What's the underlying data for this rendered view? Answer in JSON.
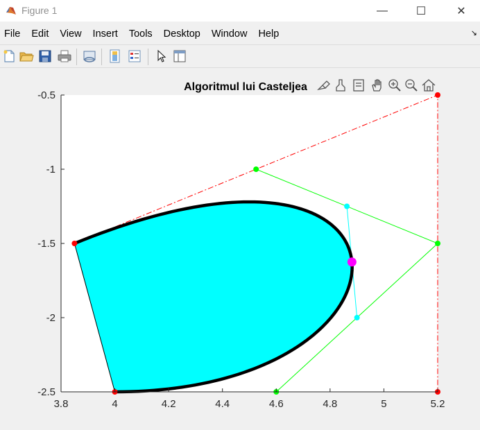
{
  "window": {
    "title": "Figure 1",
    "minimize_glyph": "—",
    "maximize_glyph": "☐",
    "close_glyph": "✕"
  },
  "menu": [
    "File",
    "Edit",
    "View",
    "Insert",
    "Tools",
    "Desktop",
    "Window",
    "Help"
  ],
  "toolbar": {
    "icons": [
      "new-figure-icon",
      "open-file-icon",
      "save-icon",
      "print-icon",
      "link-plot-icon",
      "colorbar-icon",
      "legend-icon",
      "pointer-icon",
      "property-editor-icon"
    ]
  },
  "axes_toolbar": {
    "icons": [
      "brush-edit-icon",
      "data-brush-icon",
      "datatip-icon",
      "pan-icon",
      "zoom-in-icon",
      "zoom-out-icon",
      "home-icon"
    ]
  },
  "colors": {
    "fill": "#00ffff",
    "curve": "#000000",
    "outer_polygon": "#ff0000",
    "level1": "#00ff00",
    "level2": "#00ffff",
    "point": "#ff00ff"
  },
  "chart_data": {
    "type": "line",
    "title": "Algoritmul lui Casteljea",
    "xlim": [
      3.8,
      5.2
    ],
    "ylim": [
      -2.5,
      -0.5
    ],
    "xticks": [
      "3.8",
      "4",
      "4.2",
      "4.4",
      "4.6",
      "4.8",
      "5",
      "5.2"
    ],
    "yticks": [
      "-0.5",
      "-1",
      "-1.5",
      "-2",
      "-2.5"
    ],
    "grid": false,
    "control_points": [
      [
        3.85,
        -1.5
      ],
      [
        5.2,
        -0.5
      ],
      [
        5.2,
        -2.5
      ],
      [
        4.0,
        -2.5
      ]
    ],
    "level1_points": [
      [
        4.525,
        -1.0
      ],
      [
        5.2,
        -1.5
      ],
      [
        4.6,
        -2.5
      ]
    ],
    "level2_points": [
      [
        4.8625,
        -1.25
      ],
      [
        4.9,
        -2.0
      ]
    ],
    "curve_point": {
      "t": 0.5,
      "x": 4.88125,
      "y": -1.625
    }
  }
}
